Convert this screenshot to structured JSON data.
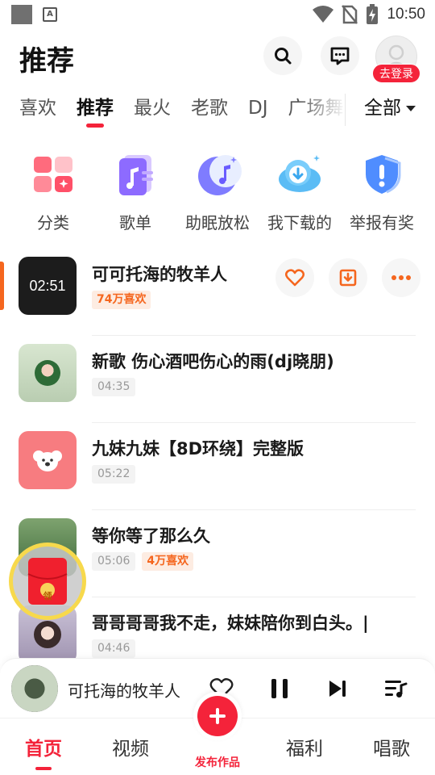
{
  "status_bar": {
    "time": "10:50",
    "app_icon": "A"
  },
  "header": {
    "title": "推荐",
    "login_badge": "去登录"
  },
  "tabs": [
    {
      "label": "喜欢"
    },
    {
      "label": "推荐"
    },
    {
      "label": "最火"
    },
    {
      "label": "老歌"
    },
    {
      "label": "DJ"
    },
    {
      "label": "广场舞"
    }
  ],
  "tab_all_label": "全部",
  "categories": [
    {
      "label": "分类",
      "icon": "grid-icon"
    },
    {
      "label": "歌单",
      "icon": "playlist-icon"
    },
    {
      "label": "助眠放松",
      "icon": "moon-music-icon"
    },
    {
      "label": "我下载的",
      "icon": "cloud-download-icon"
    },
    {
      "label": "举报有奖",
      "icon": "shield-alert-icon"
    }
  ],
  "songs": [
    {
      "title": "可可托海的牧羊人",
      "duration": "02:51",
      "likes": "74万喜欢",
      "playing": true
    },
    {
      "title": "新歌 伤心酒吧伤心的雨(dj晓朋)",
      "duration": "04:35",
      "likes": ""
    },
    {
      "title": "九妹九妹【8D环绕】完整版",
      "duration": "05:22",
      "likes": ""
    },
    {
      "title": "等你等了那么久",
      "duration": "05:06",
      "likes": "4万喜欢"
    },
    {
      "title": "哥哥哥哥我不走，妹妹陪你到白头。|",
      "duration": "04:46",
      "likes": ""
    }
  ],
  "redpacket_label": "领",
  "player": {
    "title": "可托海的牧羊人"
  },
  "bottom_nav": {
    "home": "首页",
    "video": "视频",
    "publish": "发布作品",
    "welfare": "福利",
    "sing": "唱歌"
  },
  "colors": {
    "accent": "#f4233a",
    "orange": "#f5661e"
  }
}
